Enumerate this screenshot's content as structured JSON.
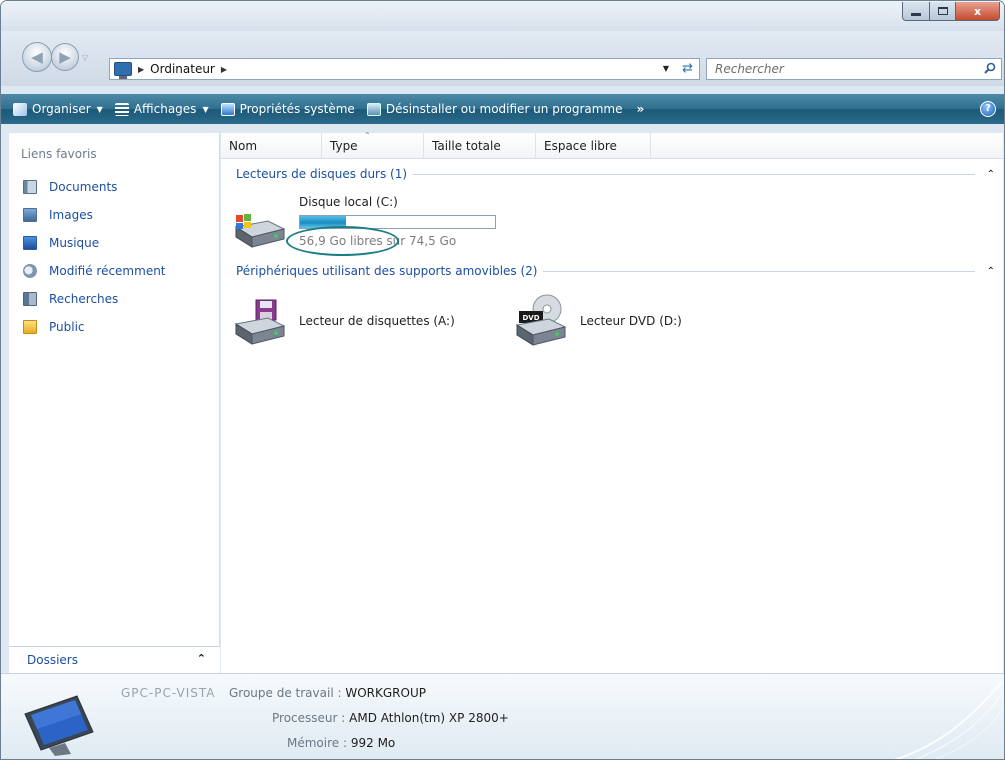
{
  "window": {
    "caption_buttons": {
      "close": "x"
    }
  },
  "address": {
    "location": "Ordinateur",
    "search_placeholder": "Rechercher"
  },
  "toolbar": {
    "items": [
      {
        "label": "Organiser",
        "has_dropdown": true
      },
      {
        "label": "Affichages",
        "has_dropdown": true
      },
      {
        "label": "Propriétés système",
        "has_dropdown": false
      },
      {
        "label": "Désinstaller ou modifier un programme",
        "has_dropdown": false
      }
    ],
    "more": "»",
    "help": "?"
  },
  "favorites": {
    "title": "Liens favoris",
    "items": [
      {
        "label": "Documents",
        "icon": "documents-icon"
      },
      {
        "label": "Images",
        "icon": "images-icon"
      },
      {
        "label": "Musique",
        "icon": "music-icon"
      },
      {
        "label": "Modifié récemment",
        "icon": "recent-icon"
      },
      {
        "label": "Recherches",
        "icon": "searches-icon"
      },
      {
        "label": "Public",
        "icon": "public-folder-icon"
      }
    ],
    "folders_label": "Dossiers"
  },
  "columns": [
    "Nom",
    "Type",
    "Taille totale",
    "Espace libre"
  ],
  "groups": [
    {
      "label": "Lecteurs de disques durs (1)",
      "items": [
        {
          "name": "Disque local (C:)",
          "free_text": "56,9 Go libres sur 74,5 Go",
          "used_fraction": 0.236
        }
      ]
    },
    {
      "label": "Périphériques utilisant des supports amovibles (2)",
      "items": [
        {
          "name": "Lecteur de disquettes (A:)"
        },
        {
          "name": "Lecteur DVD (D:)",
          "badge": "DVD"
        }
      ]
    }
  ],
  "details": {
    "computer_name": "GPC-PC-VISTA",
    "workgroup_label": "Groupe de travail :",
    "workgroup_value": "WORKGROUP",
    "processor_label": "Processeur :",
    "processor_value": "AMD Athlon(tm) XP 2800+",
    "memory_label": "Mémoire :",
    "memory_value": "992 Mo"
  },
  "colors": {
    "command_bar": "#2f6f8f",
    "link_blue": "#1c4fa1",
    "capacity_fill": "#1b8bc3",
    "annotation_oval": "#1b7f86"
  }
}
